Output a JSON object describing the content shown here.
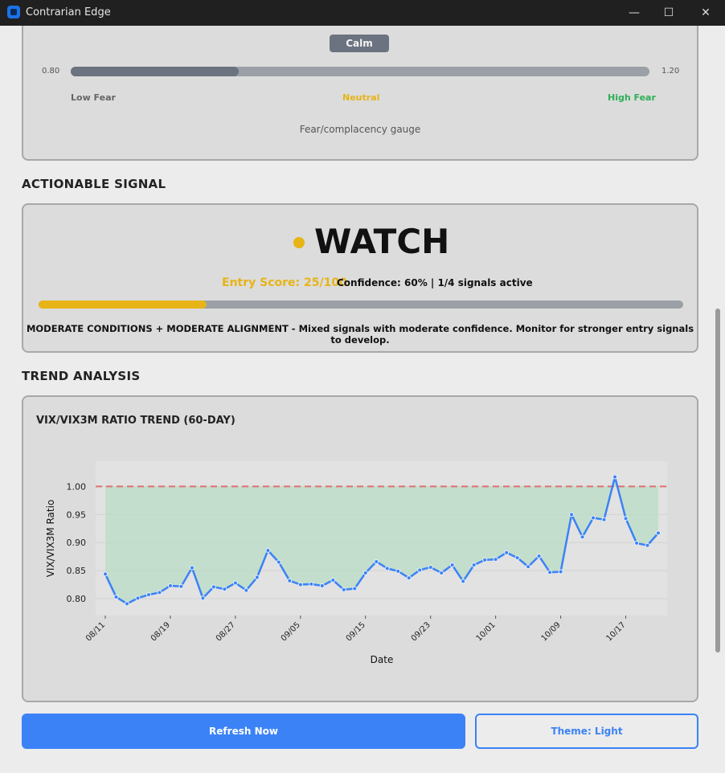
{
  "window": {
    "title": "Contrarian Edge",
    "minimize_glyph": "—",
    "maximize_glyph": "☐",
    "close_glyph": "✕"
  },
  "gauge": {
    "state_label": "Calm",
    "min_label": "0.80",
    "max_label": "1.20",
    "fill_fraction": 0.29,
    "low_label": "Low Fear",
    "neutral_label": "Neutral",
    "high_label": "High Fear",
    "caption": "Fear/complacency gauge",
    "colors": {
      "fill": "#6b7280",
      "neutral": "#e6b416",
      "high": "#2fae57"
    }
  },
  "signal": {
    "section_title": "ACTIONABLE SIGNAL",
    "word": "WATCH",
    "entry_score_label": "Entry Score: 25/100",
    "confidence_label": "Confidence: 60% | 1/4 signals active",
    "score_fraction": 0.26,
    "description": "MODERATE CONDITIONS + MODERATE ALIGNMENT - Mixed signals with moderate confidence. Monitor for stronger entry signals to develop.",
    "color": "#e6b416"
  },
  "trend": {
    "section_title": "TREND ANALYSIS",
    "chart_title": "VIX/VIX3M RATIO TREND (60-DAY)"
  },
  "chart_data": {
    "type": "line",
    "xlabel": "Date",
    "ylabel": "VIX/VIX3M Ratio",
    "ylim": [
      0.77,
      1.045
    ],
    "yticks": [
      "0.80",
      "0.85",
      "0.90",
      "0.95",
      "1.00"
    ],
    "xticks": [
      "08/11",
      "08/19",
      "08/27",
      "09/05",
      "09/15",
      "09/23",
      "10/01",
      "10/09",
      "10/17"
    ],
    "threshold": 1.0,
    "series": [
      {
        "values": [
          0.844,
          0.803,
          0.791,
          0.801,
          0.807,
          0.811,
          0.823,
          0.822,
          0.855,
          0.801,
          0.821,
          0.817,
          0.828,
          0.815,
          0.838,
          0.886,
          0.865,
          0.832,
          0.825,
          0.826,
          0.823,
          0.833,
          0.816,
          0.818,
          0.846,
          0.866,
          0.854,
          0.849,
          0.837,
          0.851,
          0.856,
          0.846,
          0.86,
          0.831,
          0.86,
          0.869,
          0.87,
          0.882,
          0.873,
          0.857,
          0.876,
          0.847,
          0.848,
          0.95,
          0.91,
          0.944,
          0.941,
          1.017,
          0.943,
          0.899,
          0.895,
          0.917
        ]
      }
    ],
    "colors": {
      "line": "#3b82f6",
      "fill": "#b8dcc4",
      "threshold": "#e07070"
    }
  },
  "buttons": {
    "refresh": "Refresh Now",
    "theme": "Theme: Light"
  }
}
